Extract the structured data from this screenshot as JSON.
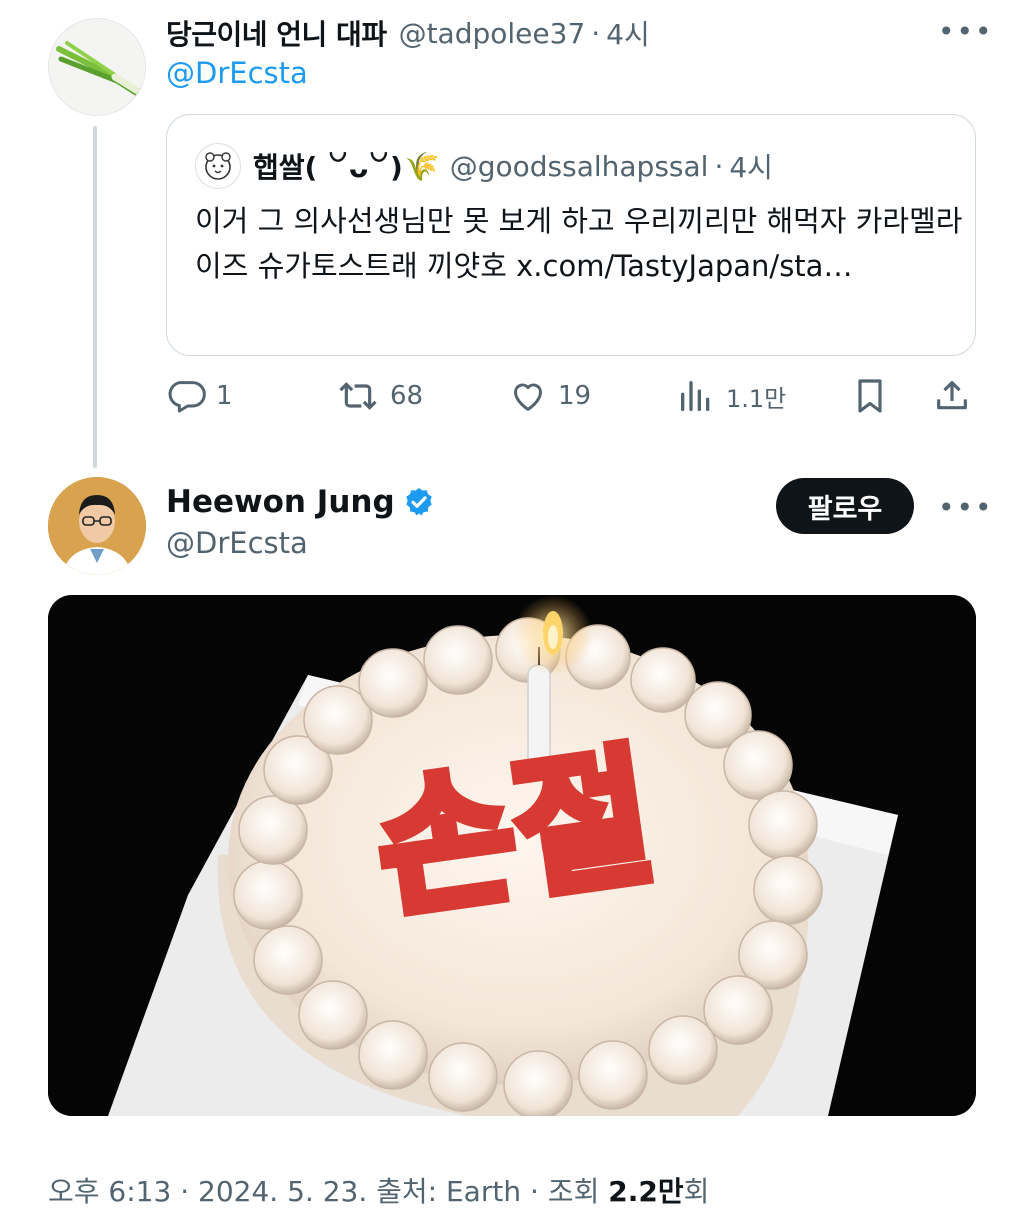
{
  "reply": {
    "name": "당근이네 언니 대파",
    "handle": "@tadpolee37",
    "time": "4시",
    "mention": "@DrEcsta",
    "avatar_icon": "green-onion-avatar"
  },
  "quote": {
    "name": "햅쌀( ꒡ᴗ꒡)",
    "name_emoji": "🌾",
    "handle": "@goodssalhapssal",
    "time": "4시",
    "text": "이거 그 의사선생님만 못 보게 하고 우리끼리만 해먹자 카라멜라이즈 슈가토스트래 끼얏호 x.com/TastyJapan/sta…",
    "avatar_icon": "cartoon-bear-avatar"
  },
  "actions": {
    "replies": "1",
    "reposts": "68",
    "likes": "19",
    "views": "1.1만"
  },
  "post": {
    "name": "Heewon Jung",
    "handle": "@DrEcsta",
    "follow_label": "팔로우",
    "verified_icon": "verified-badge-icon",
    "image_text": "손절",
    "image_alt": "birthday-cake-photo"
  },
  "footer": {
    "time": "오후 6:13",
    "date": "2024. 5. 23.",
    "source_label": "출처: Earth",
    "views_label": "조회",
    "views_count": "2.2만",
    "views_suffix": "회"
  },
  "colors": {
    "accent": "#1d9bf0",
    "text_primary": "#0f1419",
    "text_secondary": "#536471",
    "border": "#cfd9de",
    "follow_button": "#0f1419"
  }
}
